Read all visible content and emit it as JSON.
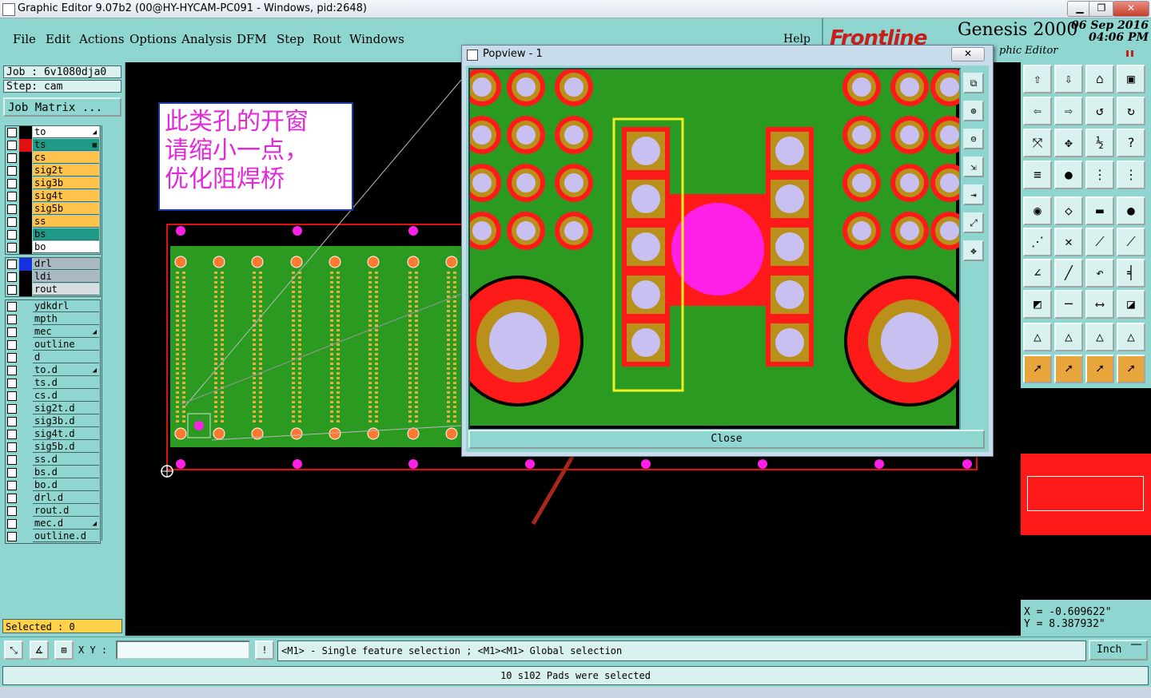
{
  "window": {
    "title": "Graphic Editor 9.07b2 (00@HY-HYCAM-PC091 - Windows, pid:2648)",
    "minimize_label": "▁",
    "maximize_label": "❐",
    "close_label": "✕"
  },
  "menu": {
    "items": [
      "File",
      "Edit",
      "Actions",
      "Options",
      "Analysis",
      "DFM",
      "Step",
      "Rout",
      "Windows"
    ],
    "help": "Help"
  },
  "brand": {
    "logo": "Frontline",
    "product": "Genesis 2000",
    "date_line1": "06 Sep 2016",
    "date_line2": "04:06 PM",
    "subtitle": "phic Editor"
  },
  "job": {
    "job_text": "Job : 6v1080dja0",
    "step_text": "Step: cam",
    "matrix_label": "Job Matrix ..."
  },
  "layers_board": [
    {
      "name": "to",
      "color": "#ffffff",
      "swatch": "#000000",
      "mark": "◢"
    },
    {
      "name": "ts",
      "color": "#1f9a86",
      "swatch": "#e01010",
      "mark": "▦"
    },
    {
      "name": "cs",
      "color": "#ffc24a",
      "swatch": "#000000",
      "mark": ""
    },
    {
      "name": "sig2t",
      "color": "#ffc24a",
      "swatch": "#000000",
      "mark": ""
    },
    {
      "name": "sig3b",
      "color": "#ffc24a",
      "swatch": "#000000",
      "mark": ""
    },
    {
      "name": "sig4t",
      "color": "#ffc24a",
      "swatch": "#000000",
      "mark": ""
    },
    {
      "name": "sig5b",
      "color": "#ffc24a",
      "swatch": "#000000",
      "mark": ""
    },
    {
      "name": "ss",
      "color": "#ffc24a",
      "swatch": "#000000",
      "mark": ""
    },
    {
      "name": "bs",
      "color": "#1f9a86",
      "swatch": "#000000",
      "mark": ""
    },
    {
      "name": "bo",
      "color": "#ffffff",
      "swatch": "#000000",
      "mark": ""
    }
  ],
  "layers_drill": [
    {
      "name": "drl",
      "color": "#a9b8c2",
      "swatch": "#1530e0",
      "mark": ""
    },
    {
      "name": "ldi",
      "color": "#a9b8c2",
      "swatch": "#000000",
      "mark": ""
    },
    {
      "name": "rout",
      "color": "#d7dde0",
      "swatch": "#000000",
      "mark": ""
    }
  ],
  "layers_misc": [
    {
      "name": "ydkdrl",
      "color": "#8fd5d0",
      "mark": ""
    },
    {
      "name": "mpth",
      "color": "#8fd5d0",
      "mark": ""
    },
    {
      "name": "mec",
      "color": "#8fd5d0",
      "mark": "◢"
    },
    {
      "name": "outline",
      "color": "#8fd5d0",
      "mark": ""
    },
    {
      "name": "d",
      "color": "#8fd5d0",
      "mark": ""
    },
    {
      "name": "to.d",
      "color": "#8fd5d0",
      "mark": "◢"
    },
    {
      "name": "ts.d",
      "color": "#8fd5d0",
      "mark": ""
    },
    {
      "name": "cs.d",
      "color": "#8fd5d0",
      "mark": ""
    },
    {
      "name": "sig2t.d",
      "color": "#8fd5d0",
      "mark": ""
    },
    {
      "name": "sig3b.d",
      "color": "#8fd5d0",
      "mark": ""
    },
    {
      "name": "sig4t.d",
      "color": "#8fd5d0",
      "mark": ""
    },
    {
      "name": "sig5b.d",
      "color": "#8fd5d0",
      "mark": ""
    },
    {
      "name": "ss.d",
      "color": "#8fd5d0",
      "mark": ""
    },
    {
      "name": "bs.d",
      "color": "#8fd5d0",
      "mark": ""
    },
    {
      "name": "bo.d",
      "color": "#8fd5d0",
      "mark": ""
    },
    {
      "name": "drl.d",
      "color": "#8fd5d0",
      "mark": ""
    },
    {
      "name": "rout.d",
      "color": "#8fd5d0",
      "mark": ""
    },
    {
      "name": "mec.d",
      "color": "#8fd5d0",
      "mark": "◢"
    },
    {
      "name": "outline.d",
      "color": "#8fd5d0",
      "mark": ""
    }
  ],
  "selected_text": "Selected : 0",
  "annotation": {
    "line1": "此类孔的开窗",
    "line2": "请缩小一点，",
    "line3": "优化阻焊桥"
  },
  "popview": {
    "title": "Popview - 1",
    "close_label": "Close",
    "x_label": "✕"
  },
  "coords": {
    "x": "X = -0.609622\"",
    "y": "Y = 8.387932\""
  },
  "status": {
    "xy_label": "X Y :",
    "xy_value": "",
    "hint": "<M1> - Single feature selection ; <M1><M1> Global selection",
    "units": "Inch",
    "message": "10 s102 Pads were selected"
  },
  "colors": {
    "panel": "#8fd5d0",
    "board_green": "#2a9a20",
    "copper": "#ff1a1a",
    "mask": "#b8901a",
    "drill": "#c8c0f0",
    "magenta": "#ff20e8",
    "highlight": "#f0f020"
  }
}
